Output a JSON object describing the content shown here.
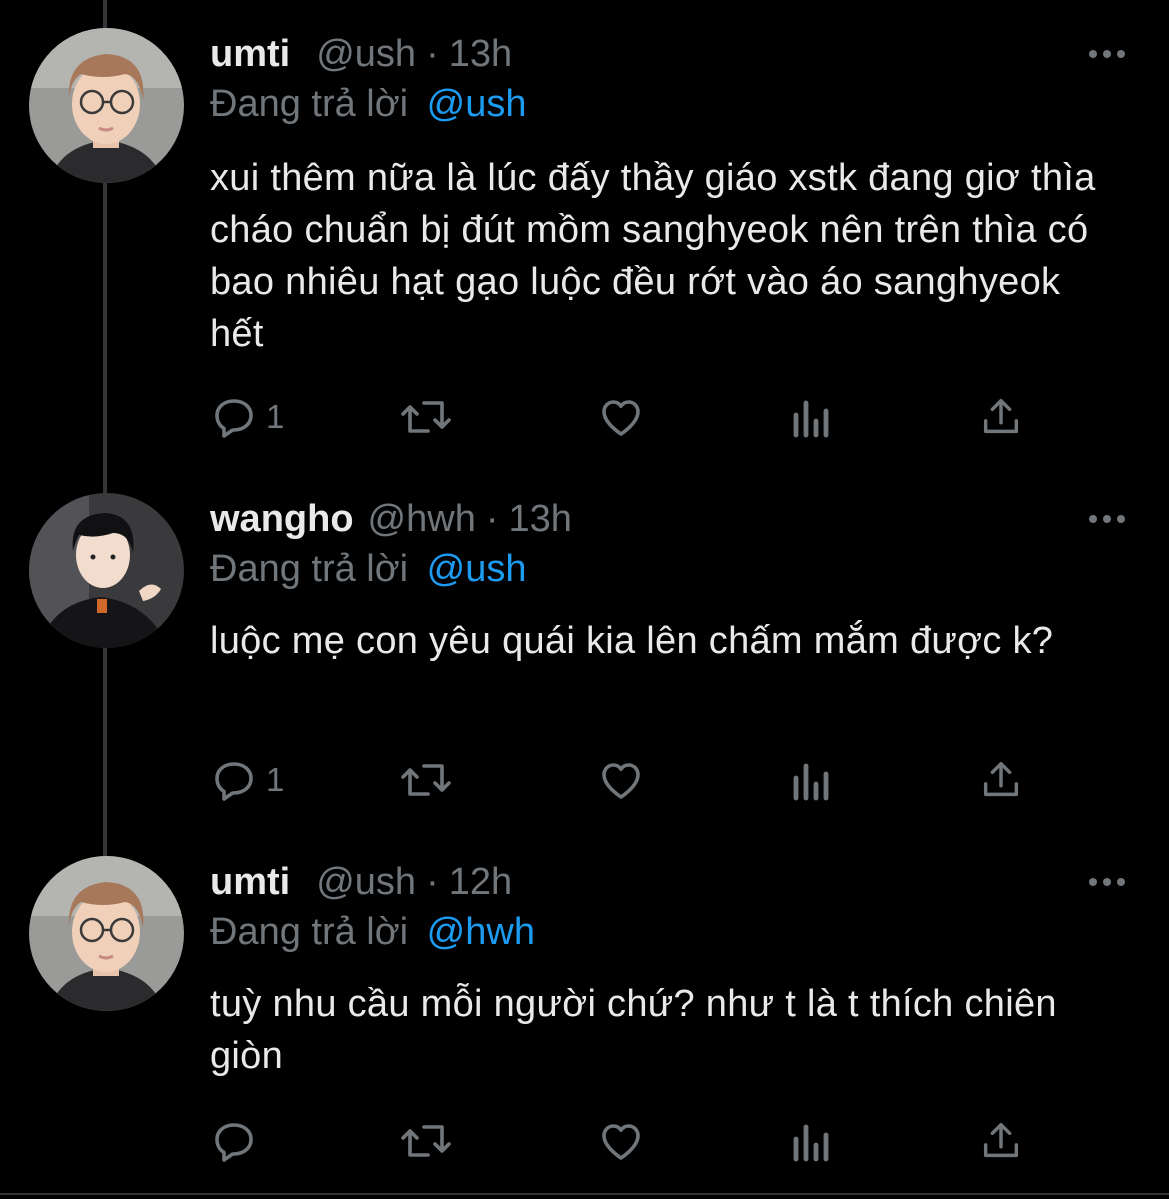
{
  "colors": {
    "background": "#000000",
    "text": "#e7e9ea",
    "muted": "#71767b",
    "accent": "#1d9bf0",
    "thread_line": "#333639"
  },
  "reply_prefix": "Đang trả lời",
  "tweets": [
    {
      "display_name": "umti",
      "handle": "@ush",
      "separator": "·",
      "time": "13h",
      "reply_to": "@ush",
      "text": "xui thêm nữa là lúc đấy thầy giáo xstk đang giơ thìa cháo chuẩn bị đút mồm sanghyeok nên trên thìa có bao nhiêu hạt gạo luộc đều rớt vào áo sanghyeok hết",
      "reply_count": "1",
      "icons": [
        "reply-icon",
        "retweet-icon",
        "like-icon",
        "views-icon",
        "share-icon",
        "more-icon"
      ]
    },
    {
      "display_name": "wangho",
      "handle": "@hwh",
      "separator": "·",
      "time": "13h",
      "reply_to": "@ush",
      "text": "luộc mẹ con yêu quái kia lên chấm mắm được k?",
      "reply_count": "1",
      "icons": [
        "reply-icon",
        "retweet-icon",
        "like-icon",
        "views-icon",
        "share-icon",
        "more-icon"
      ]
    },
    {
      "display_name": "umti",
      "handle": "@ush",
      "separator": "·",
      "time": "12h",
      "reply_to": "@hwh",
      "text": "tuỳ nhu cầu mỗi người chứ? như t là t thích chiên giòn",
      "reply_count": "",
      "icons": [
        "reply-icon",
        "retweet-icon",
        "like-icon",
        "views-icon",
        "share-icon",
        "more-icon"
      ]
    }
  ]
}
